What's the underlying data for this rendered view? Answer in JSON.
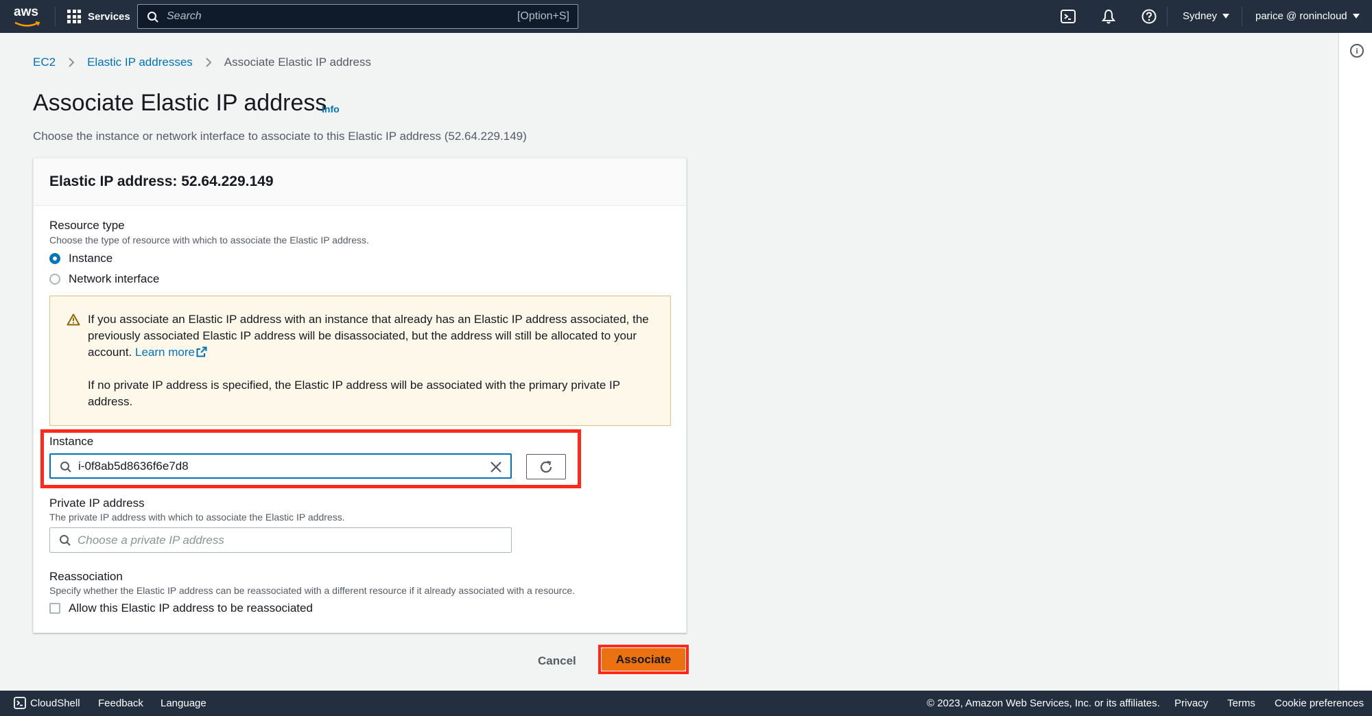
{
  "topnav": {
    "logo_text": "aws",
    "services_label": "Services",
    "search_placeholder": "Search",
    "search_shortcut": "[Option+S]",
    "region": "Sydney",
    "account": "parice @ ronincloud"
  },
  "breadcrumb": {
    "items": [
      "EC2",
      "Elastic IP addresses",
      "Associate Elastic IP address"
    ]
  },
  "page": {
    "title": "Associate Elastic IP address",
    "info_link": "Info",
    "description": "Choose the instance or network interface to associate to this Elastic IP address (52.64.229.149)"
  },
  "panel": {
    "title": "Elastic IP address: 52.64.229.149",
    "resource_type": {
      "label": "Resource type",
      "description": "Choose the type of resource with which to associate the Elastic IP address.",
      "options": [
        "Instance",
        "Network interface"
      ],
      "selected": "Instance"
    },
    "alert": {
      "para1": "If you associate an Elastic IP address with an instance that already has an Elastic IP address associated, the previously associated Elastic IP address will be disassociated, but the address will still be allocated to your account.",
      "learn_more": "Learn more",
      "para2": "If no private IP address is specified, the Elastic IP address will be associated with the primary private IP address."
    },
    "instance": {
      "label": "Instance",
      "value": "i-0f8ab5d8636f6e7d8"
    },
    "private_ip": {
      "label": "Private IP address",
      "description": "The private IP address with which to associate the Elastic IP address.",
      "placeholder": "Choose a private IP address"
    },
    "reassociation": {
      "label": "Reassociation",
      "description": "Specify whether the Elastic IP address can be reassociated with a different resource if it already associated with a resource.",
      "checkbox_label": "Allow this Elastic IP address to be reassociated",
      "checked": false
    }
  },
  "actions": {
    "cancel": "Cancel",
    "associate": "Associate"
  },
  "footer": {
    "cloudshell": "CloudShell",
    "feedback": "Feedback",
    "language": "Language",
    "copyright": "© 2023, Amazon Web Services, Inc. or its affiliates.",
    "privacy": "Privacy",
    "terms": "Terms",
    "cookie": "Cookie preferences"
  },
  "colors": {
    "nav_bg": "#232f3e",
    "link": "#0073bb",
    "primary_button": "#ec7211",
    "highlight_box": "#ff2a1a",
    "alert_bg": "#fef8ea"
  }
}
